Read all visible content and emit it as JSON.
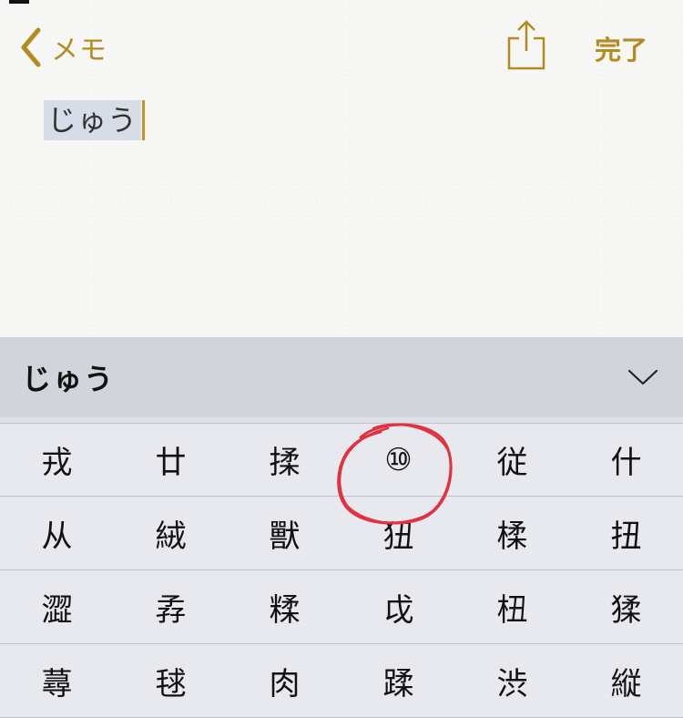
{
  "nav": {
    "back_label": "メモ",
    "done_label": "完了"
  },
  "note": {
    "text": "じゅう"
  },
  "keyboard": {
    "reading": "じゅう",
    "rows": [
      [
        "戎",
        "廿",
        "揉",
        "⑩",
        "従",
        "什"
      ],
      [
        "从",
        "絨",
        "獸",
        "狃",
        "楺",
        "扭"
      ],
      [
        "澀",
        "孨",
        "糅",
        "戉",
        "杻",
        "猱"
      ],
      [
        "蕁",
        "毬",
        "肉",
        "蹂",
        "渋",
        "縦"
      ]
    ]
  },
  "colors": {
    "accent": "#b58a1e",
    "annotation": "#e0323f",
    "keyboard_bg": "#dfe0e6",
    "selection": "#d7dde6"
  },
  "annotation": {
    "circled_candidate": "⑩"
  }
}
